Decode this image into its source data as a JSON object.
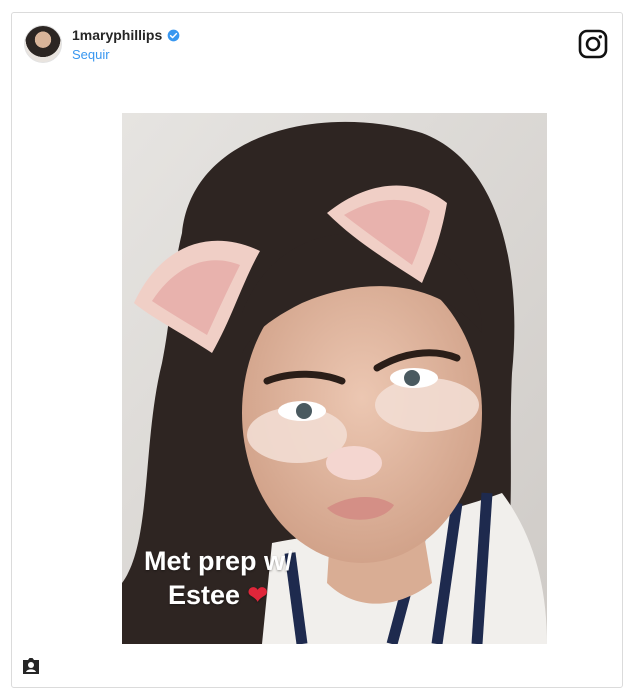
{
  "post": {
    "username": "1maryphillips",
    "follow_label": "Sequir",
    "verified": true,
    "caption_line1": "Met prep w/",
    "caption_line2": "Estee",
    "caption_emoji": "❤"
  },
  "icons": {
    "avatar": "user-avatar",
    "verified": "verified-badge-icon",
    "brand": "instagram-logo-icon",
    "profile": "profile-icon"
  },
  "colors": {
    "link": "#3897f0",
    "verified": "#3897f0",
    "heart": "#e0263a",
    "border": "#dbdbdb"
  }
}
